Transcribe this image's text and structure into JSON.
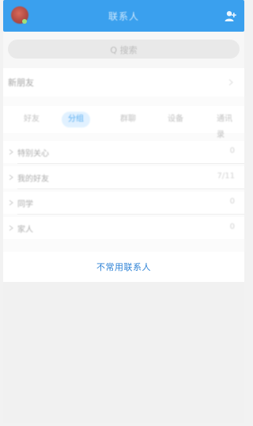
{
  "header": {
    "title": "联系人",
    "avatar_icon": "avatar-icon",
    "add_icon": "add-contact-icon"
  },
  "search": {
    "placeholder": "Q 搜索",
    "icon": "search-icon"
  },
  "rows": {
    "new_friends": "新朋友"
  },
  "tabs": [
    {
      "label": "好友"
    },
    {
      "label": "分组"
    },
    {
      "label": "群聊"
    },
    {
      "label": "设备"
    },
    {
      "label": "通讯录"
    }
  ],
  "groups": [
    {
      "name": "特别关心",
      "count": "0"
    },
    {
      "name": "我的好友",
      "count": "7/11"
    },
    {
      "name": "同学",
      "count": "0"
    },
    {
      "name": "家人",
      "count": "0"
    }
  ],
  "footer": {
    "rare_contacts": "不常用联系人"
  },
  "colors": {
    "accent": "#3aa0ee",
    "link": "#2f83d6",
    "background": "#f2f2f2"
  }
}
